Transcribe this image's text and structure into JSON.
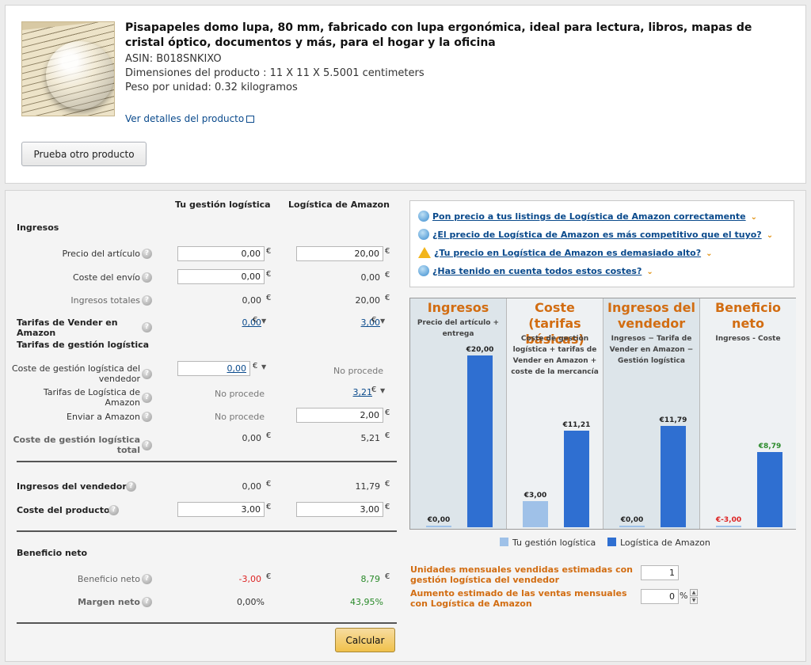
{
  "product": {
    "title": "Pisapapeles domo lupa, 80 mm, fabricado con lupa ergonómica, ideal para lectura, libros, mapas de cristal óptico, documentos y más, para el hogar y la oficina",
    "asin": "ASIN: B018SNKIXO",
    "dimensions": "Dimensiones del producto : 11 X 11 X 5.5001 centimeters",
    "weight": "Peso por unidad: 0.32 kilogramos",
    "details_link": "Ver detalles del producto",
    "try_button": "Prueba otro producto"
  },
  "calc": {
    "col_own": "Tu gestión logística",
    "col_amazon": "Logística de Amazon",
    "currency": "€",
    "sections": {
      "ingresos": "Ingresos",
      "tarifas_gestion": "Tarifas de gestión logística",
      "beneficio": "Beneficio neto"
    },
    "rows": {
      "precio": {
        "label": "Precio del artículo",
        "own": "0,00",
        "amazon": "20,00"
      },
      "envio": {
        "label": "Coste del envío",
        "own": "0,00",
        "amazon": "0,00"
      },
      "ingresos_totales": {
        "label": "Ingresos totales",
        "own": "0,00",
        "amazon": "20,00"
      },
      "tarifas_vender": {
        "label": "Tarifas de Vender en Amazon",
        "own": "0,00",
        "amazon": "3,00"
      },
      "coste_gestion_vendedor": {
        "label": "Coste de gestión logística del vendedor",
        "own": "0,00",
        "amazon": "No procede"
      },
      "tarifas_logistica": {
        "label": "Tarifas de Logística de Amazon",
        "own": "No procede",
        "amazon": "3,21"
      },
      "enviar_amazon": {
        "label": "Enviar a Amazon",
        "own": "No procede",
        "amazon": "2,00"
      },
      "coste_total": {
        "label": "Coste de gestión logística total",
        "own": "0,00",
        "amazon": "5,21"
      },
      "ingresos_vendedor": {
        "label": "Ingresos del vendedor",
        "own": "0,00",
        "amazon": "11,79"
      },
      "coste_producto": {
        "label": "Coste del producto",
        "own": "3,00",
        "amazon": "3,00"
      },
      "beneficio_neto": {
        "label": "Beneficio neto",
        "own": "-3,00",
        "amazon": "8,79"
      },
      "margen_neto": {
        "label": "Margen neto",
        "own": "0,00%",
        "amazon": "43,95%"
      }
    },
    "calculate_button": "Calcular"
  },
  "tips": [
    {
      "text": "Pon precio a tus listings de Logística de Amazon correctamente",
      "icon": "speech-bubble-icon"
    },
    {
      "text": "¿El precio de Logística de Amazon es más competitivo que el tuyo?",
      "icon": "speech-bubble-icon"
    },
    {
      "text": "¿Tu precio en Logística de Amazon es demasiado alto?",
      "icon": "warning-icon"
    },
    {
      "text": "¿Has tenido en cuenta todos estos costes?",
      "icon": "speech-bubble-icon"
    }
  ],
  "chart_data": {
    "type": "bar",
    "categories": [
      "Ingresos",
      "Coste (tarifas básicas)",
      "Ingresos del vendedor",
      "Beneficio neto"
    ],
    "subtitles": [
      "Precio del artículo + entrega",
      "Coste de gestión logística + tarifas de Vender en Amazon + coste de la mercancía",
      "Ingresos − Tarifa de Vender en Amazon − Gestión logística",
      "Ingresos - Coste"
    ],
    "series": [
      {
        "name": "Tu gestión logística",
        "values": [
          0,
          3.0,
          0,
          -3.0
        ],
        "labels": [
          "€0,00",
          "€3,00",
          "€0,00",
          "€-3,00"
        ],
        "color": "#9fc1e8"
      },
      {
        "name": "Logística de Amazon",
        "values": [
          20.0,
          11.21,
          11.79,
          8.79
        ],
        "labels": [
          "€20,00",
          "€11,21",
          "€11,79",
          "€8,79"
        ],
        "color": "#2f6fd1"
      }
    ],
    "ylim": [
      0,
      20
    ]
  },
  "estimates": {
    "units_label": "Unidades mensuales vendidas estimadas con gestión logística del vendedor",
    "units_value": "1",
    "increase_label": "Aumento estimado de las ventas mensuales con Logística de Amazon",
    "increase_value": "0",
    "percent": "%"
  }
}
